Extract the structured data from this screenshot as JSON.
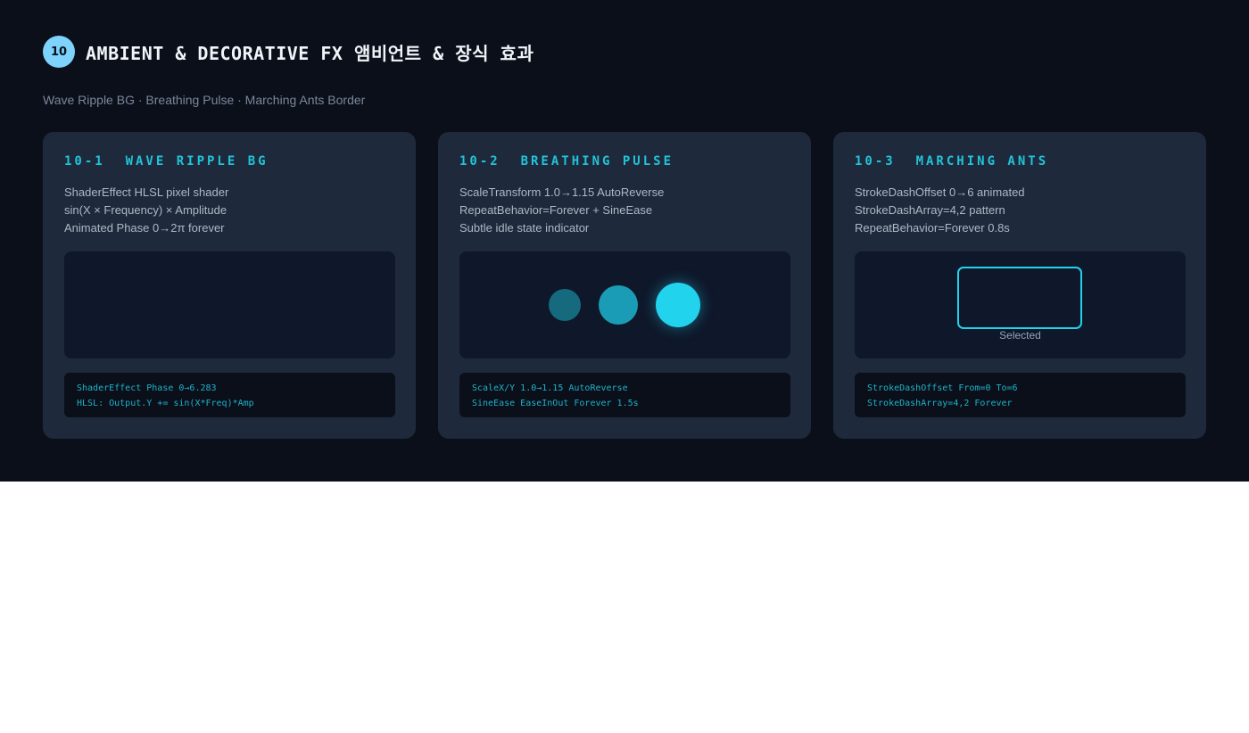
{
  "header": {
    "number": "10",
    "title": "AMBIENT & DECORATIVE FX  앰비언트 & 장식 효과",
    "subtitle": "Wave Ripple BG · Breathing Pulse · Marching Ants Border"
  },
  "cards": [
    {
      "heading": "10-1  WAVE RIPPLE BG",
      "desc": [
        "ShaderEffect HLSL pixel shader",
        "sin(X × Frequency) × Amplitude",
        "Animated Phase 0→2π forever"
      ],
      "code": [
        "ShaderEffect Phase 0→6.283",
        "HLSL: Output.Y += sin(X*Freq)*Amp"
      ]
    },
    {
      "heading": "10-2  BREATHING PULSE",
      "desc": [
        "ScaleTransform 1.0→1.15 AutoReverse",
        "RepeatBehavior=Forever + SineEase",
        "Subtle idle state indicator"
      ],
      "code": [
        "ScaleX/Y 1.0→1.15 AutoReverse",
        "SineEase EaseInOut Forever 1.5s"
      ]
    },
    {
      "heading": "10-3  MARCHING ANTS",
      "desc": [
        "StrokeDashOffset 0→6 animated",
        "StrokeDashArray=4,2 pattern",
        "RepeatBehavior=Forever 0.8s"
      ],
      "code": [
        "StrokeDashOffset From=0 To=6",
        "StrokeDashArray=4,2 Forever"
      ],
      "demo_label": "Selected"
    }
  ],
  "colors": {
    "background": "#0a0f1a",
    "card": "#1e293b",
    "accent": "#22d3ee",
    "badge": "#7dd3fc"
  }
}
